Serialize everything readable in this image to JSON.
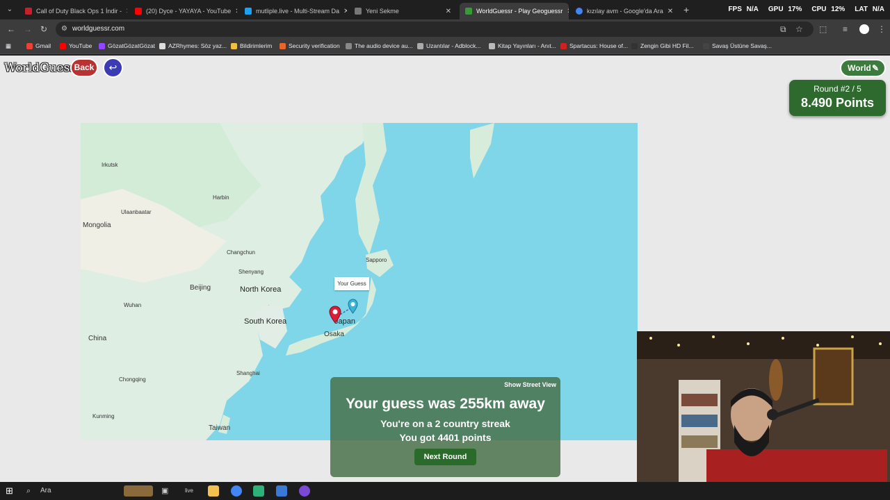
{
  "browser": {
    "tabs": [
      {
        "title": "Call of Duty Black Ops 1 İndir -",
        "color": "#c8202b"
      },
      {
        "title": "(20) Dyce - YAYAYA - YouTube",
        "color": "#ff0000"
      },
      {
        "title": "mutliple.live - Multi-Stream Da",
        "color": "#1da1f2"
      },
      {
        "title": "Yeni Sekme",
        "color": "#777777"
      },
      {
        "title": "WorldGuessr - Play Geoguessr",
        "color": "#3a9a3a"
      },
      {
        "title": "kızılay avm - Google'da Ara",
        "color": "#4285f4"
      }
    ],
    "active_tab": 4,
    "url": "worldguessr.com",
    "stats": {
      "fps_label": "FPS",
      "fps": "N/A",
      "gpu_label": "GPU",
      "gpu": "17%",
      "cpu_label": "CPU",
      "cpu": "12%",
      "lat_label": "LAT",
      "lat": "N/A"
    },
    "bookmarks": [
      {
        "label": "Gmail",
        "color": "#ea4335"
      },
      {
        "label": "YouTube",
        "color": "#ff0000"
      },
      {
        "label": "GözatGözatGözat",
        "color": "#9146ff"
      },
      {
        "label": "AZRhymes: Söz yaz...",
        "color": "#dddddd"
      },
      {
        "label": "Bildirimlerim",
        "color": "#f0c040"
      },
      {
        "label": "Security verification",
        "color": "#e8652e"
      },
      {
        "label": "The audio device au...",
        "color": "#888888"
      },
      {
        "label": "Uzantılar - Adblock...",
        "color": "#aaaaaa"
      },
      {
        "label": "Kitap Yayınları - Anıt...",
        "color": "#bbbbbb"
      },
      {
        "label": "Spartacus: House of...",
        "color": "#cc2222"
      },
      {
        "label": "Zengin Gibi HD Fil...",
        "color": "#333333"
      },
      {
        "label": "Savaş Üstüne Savaş...",
        "color": "#444444"
      }
    ]
  },
  "game": {
    "logo": "WorldGuessr",
    "back_label": "Back",
    "undo_icon": "↩",
    "world_label": "World",
    "round_text": "Round #2 / 5",
    "points_text": "8.490 Points"
  },
  "map": {
    "labels": {
      "mongolia": "Mongolia",
      "china": "China",
      "beijing": "Beijing",
      "north_korea": "North Korea",
      "south_korea": "South Korea",
      "japan": "Japan",
      "osaka": "Osaka",
      "sapporo": "Sapporo",
      "taiwan": "Taiwan",
      "irkutsk": "Irkutsk",
      "ulaanbaatar": "Ulaanbaatar",
      "shenyang": "Shenyang",
      "changchun": "Changchun",
      "harbin": "Harbin",
      "chongqing": "Chongqing",
      "kunming": "Kunming",
      "wuhan": "Wuhan",
      "shanghai": "Shanghai"
    },
    "tooltip": "Your Guess",
    "guess_marker": "red-pin-icon",
    "actual_marker": "blue-pin-icon"
  },
  "result": {
    "show_street_view": "Show Street View",
    "distance_text": "Your guess was 255km away",
    "streak_text": "You're on a 2 country streak",
    "points_text": "You got 4401 points",
    "next_label": "Next Round"
  },
  "taskbar": {
    "search_label": "Ara"
  }
}
